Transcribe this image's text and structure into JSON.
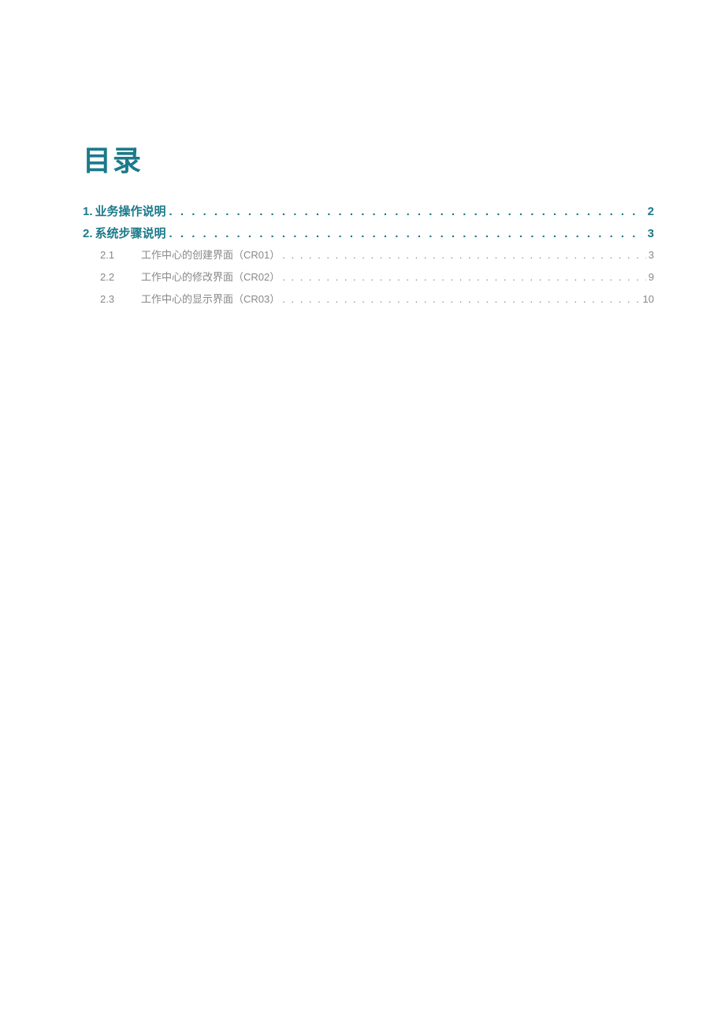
{
  "title": "目录",
  "entries": [
    {
      "level": 1,
      "number": "1.",
      "text": "业务操作说明",
      "page": "2"
    },
    {
      "level": 1,
      "number": "2.",
      "text": "系统步骤说明",
      "page": "3"
    },
    {
      "level": 2,
      "number": "2.1",
      "text": "工作中心的创建界面（CR01）",
      "page": "3"
    },
    {
      "level": 2,
      "number": "2.2",
      "text": "工作中心的修改界面（CR02）",
      "page": "9"
    },
    {
      "level": 2,
      "number": "2.3",
      "text": "工作中心的显示界面（CR03）",
      "page": "10"
    }
  ],
  "dots1": ". . . . . . . . . . . . . . . . . . . . . . . . . . . . . . . . . . . . . . . . . . . . . . . . . . . . . . . . . . . . . . . . . . . . . . . . . . . . . . . . . . . . . . . . . . . . . . . . . . . . . . . . . . . . . . . . . . . . . . . .",
  "dots2": ". . . . . . . . . . . . . . . . . . . . . . . . . . . . . . . . . . . . . . . . . . . . . . . . . . . . . . . . . . . . . . . . . . . . . . . . . . . . . . . . . . . . . . . . . . . . . . . . . . . . . . . . . . . . . . . . . . . . . . . ."
}
